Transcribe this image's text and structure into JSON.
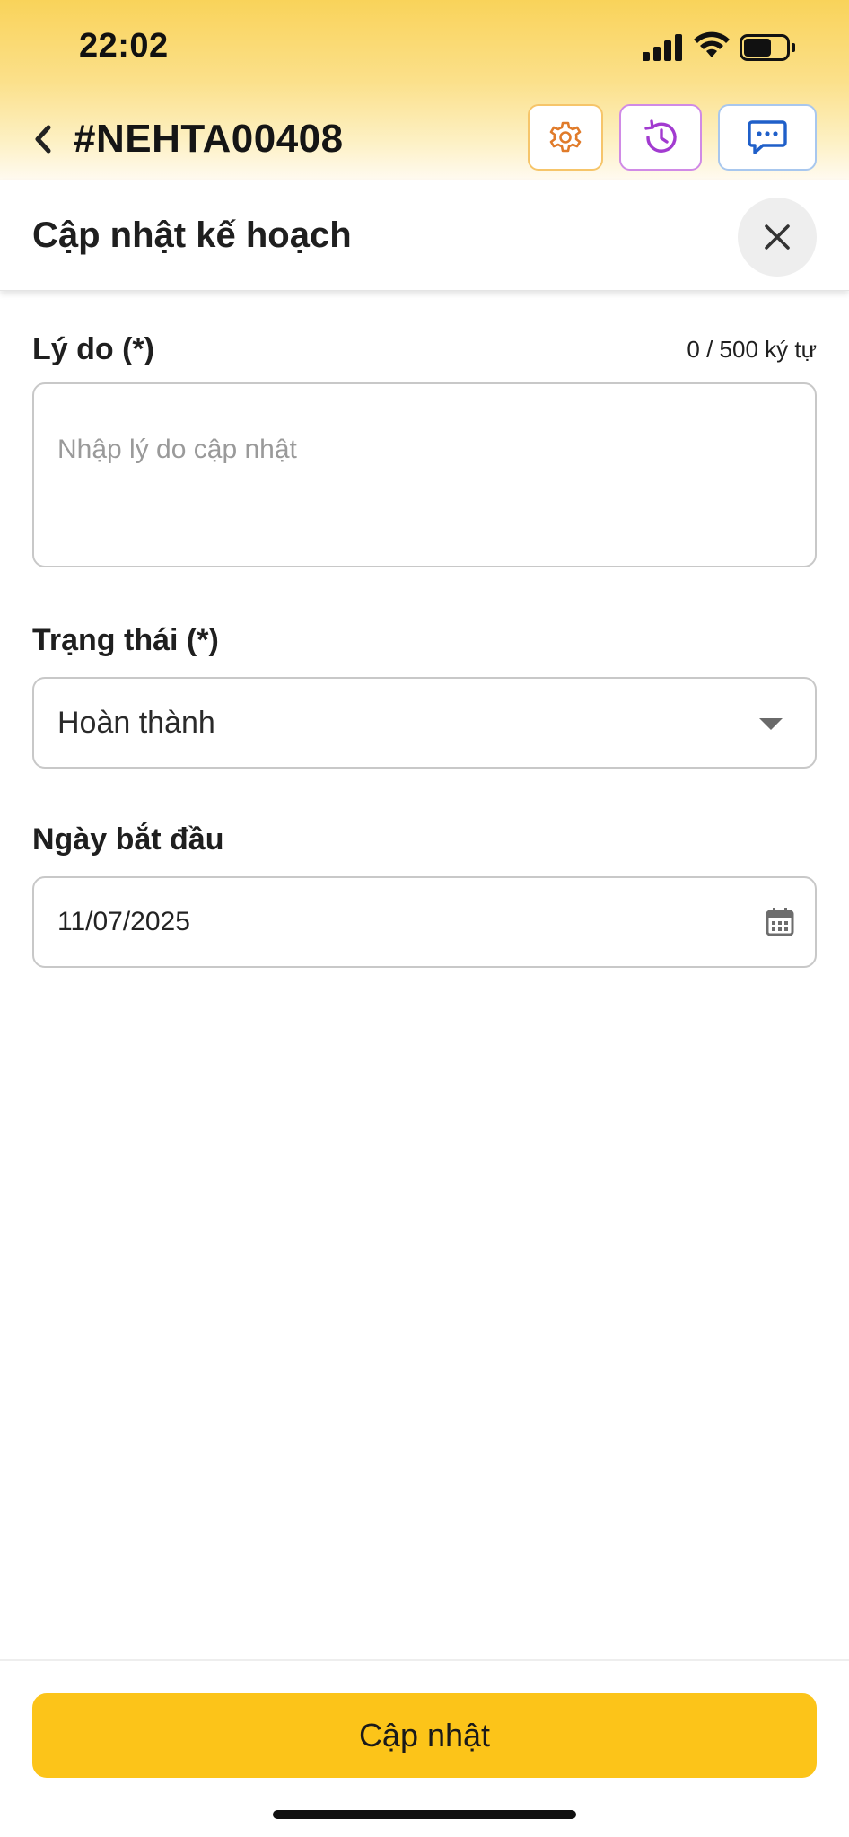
{
  "status_bar": {
    "time": "22:02"
  },
  "nav": {
    "ticket_id": "#NEHTA00408"
  },
  "panel": {
    "title": "Cập nhật kế hoạch"
  },
  "form": {
    "reason": {
      "label": "Lý do (*)",
      "counter": "0 / 500 ký tự",
      "placeholder": "Nhập lý do cập nhật",
      "value": ""
    },
    "status": {
      "label": "Trạng thái (*)",
      "selected": "Hoàn thành"
    },
    "start_date": {
      "label": "Ngày bắt đầu",
      "value": "11/07/2025"
    }
  },
  "footer": {
    "submit_label": "Cập nhật"
  },
  "colors": {
    "accent": "#fcc419",
    "header_gradient_top": "#f9d35a",
    "settings_icon": "#e07b2a",
    "history_icon": "#a23bd0",
    "chat_icon": "#1f5fc9"
  },
  "icons": [
    "chevron-left-icon",
    "gear-icon",
    "history-icon",
    "chat-icon",
    "close-icon",
    "caret-down-icon",
    "calendar-icon"
  ]
}
